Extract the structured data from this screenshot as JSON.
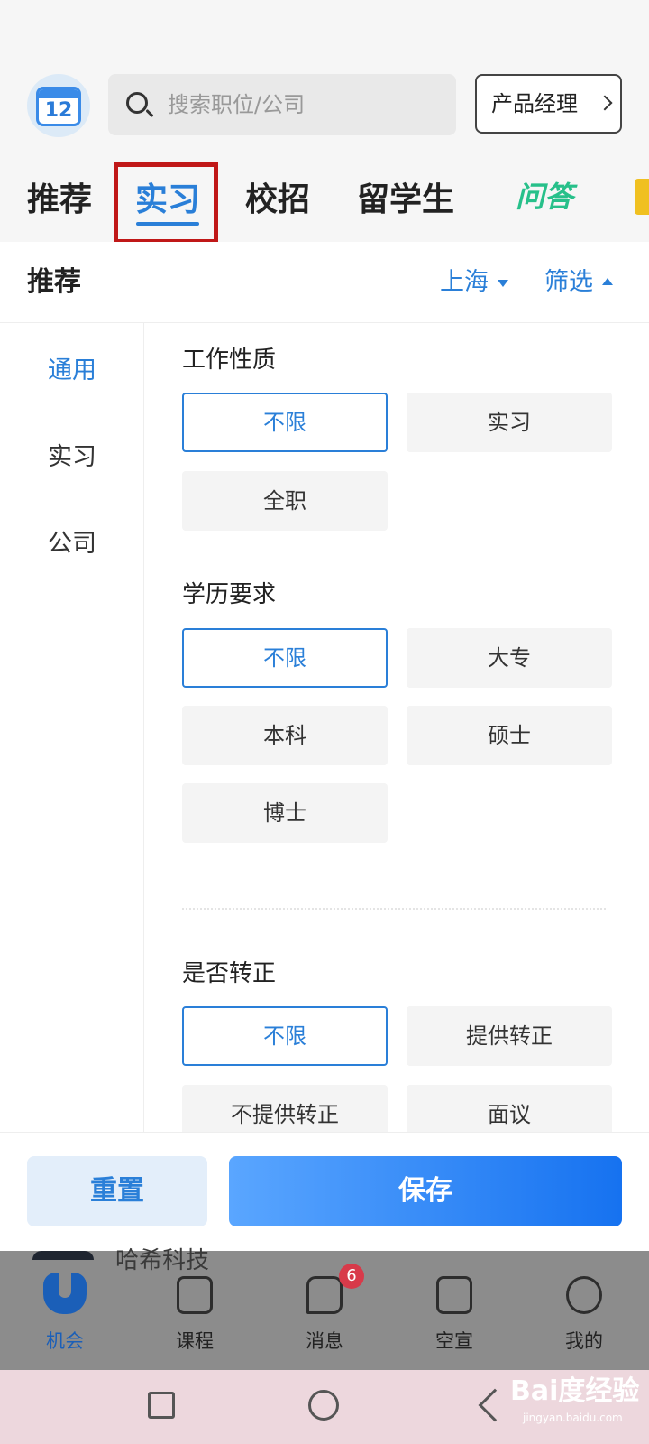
{
  "search": {
    "placeholder": "搜索职位/公司"
  },
  "calendar": {
    "day": "12"
  },
  "job_filter": {
    "label": "产品经理"
  },
  "tabs": [
    {
      "label": "推荐"
    },
    {
      "label": "实习"
    },
    {
      "label": "校招"
    },
    {
      "label": "留学生"
    },
    {
      "label": "问答"
    }
  ],
  "subheader": {
    "title": "推荐",
    "city": "上海",
    "filter": "筛选"
  },
  "side_menu": [
    "通用",
    "实习",
    "公司"
  ],
  "sections": [
    {
      "title": "工作性质",
      "options": [
        "不限",
        "实习",
        "全职"
      ]
    },
    {
      "title": "学历要求",
      "options": [
        "不限",
        "大专",
        "本科",
        "硕士",
        "博士"
      ]
    },
    {
      "title": "是否转正",
      "options": [
        "不限",
        "提供转正",
        "不提供转正",
        "面议"
      ]
    }
  ],
  "actions": {
    "reset": "重置",
    "save": "保存"
  },
  "peek_item": {
    "text": "哈希科技"
  },
  "bottom_nav": [
    {
      "label": "机会"
    },
    {
      "label": "课程"
    },
    {
      "label": "消息",
      "badge": "6"
    },
    {
      "label": "空宣"
    },
    {
      "label": "我的"
    }
  ],
  "watermark": {
    "text": "Bai度经验",
    "sub": "jingyan.baidu.com"
  },
  "colors": {
    "accent": "#2a7fd8",
    "highlight_box": "#c01818",
    "badge": "#d83a4a"
  }
}
